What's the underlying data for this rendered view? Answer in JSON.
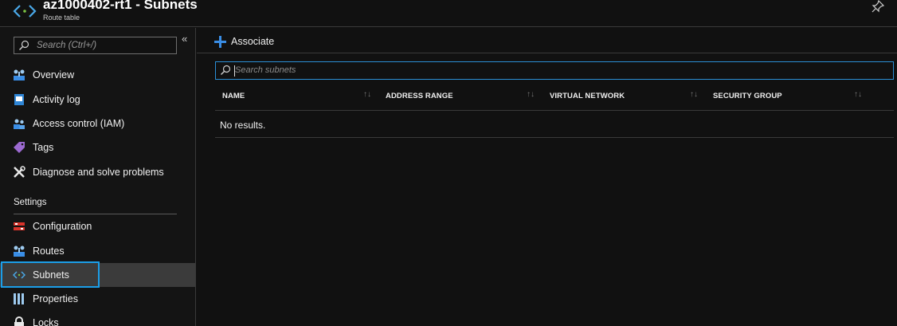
{
  "header": {
    "title": "az1000402-rt1 - Subnets",
    "subtitle": "Route table",
    "icon": "subnet-brackets-icon",
    "pin_icon": "pin-icon"
  },
  "sidebar": {
    "search_placeholder": "Search (Ctrl+/)",
    "collapse_glyph": "«",
    "items": [
      {
        "label": "Overview",
        "icon": "route-table-icon"
      },
      {
        "label": "Activity log",
        "icon": "activity-log-icon"
      },
      {
        "label": "Access control (IAM)",
        "icon": "iam-people-icon"
      },
      {
        "label": "Tags",
        "icon": "tag-icon"
      },
      {
        "label": "Diagnose and solve problems",
        "icon": "wrench-icon"
      }
    ],
    "section_settings": "Settings",
    "settings_items": [
      {
        "label": "Configuration",
        "icon": "configuration-icon"
      },
      {
        "label": "Routes",
        "icon": "route-table-icon"
      },
      {
        "label": "Subnets",
        "icon": "subnet-brackets-icon",
        "active": true
      },
      {
        "label": "Properties",
        "icon": "properties-bars-icon"
      },
      {
        "label": "Locks",
        "icon": "lock-icon"
      }
    ]
  },
  "toolbar": {
    "associate_label": "Associate"
  },
  "search": {
    "placeholder": "Search subnets"
  },
  "table": {
    "columns": [
      "NAME",
      "ADDRESS RANGE",
      "VIRTUAL NETWORK",
      "SECURITY GROUP"
    ],
    "sort_glyph": "↑↓",
    "empty_text": "No results."
  },
  "colors": {
    "accent": "#1b9ee8",
    "background": "#111111",
    "active_row": "#3b3b3b"
  }
}
